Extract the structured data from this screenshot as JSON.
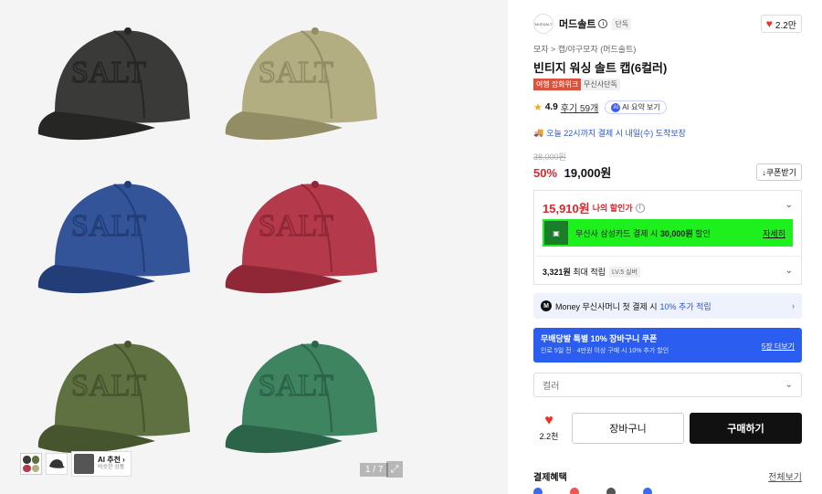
{
  "gallery": {
    "pager": "1 / 7",
    "ai_rec_title": "AI 추천 ›",
    "ai_rec_sub": "비슷한 상품",
    "caps": [
      {
        "color": "#3a3a38",
        "shade": "#262624",
        "text": "SALT"
      },
      {
        "color": "#b3ad82",
        "shade": "#938d65",
        "text": "SALT"
      },
      {
        "color": "#34549a",
        "shade": "#223d78",
        "text": "SALT"
      },
      {
        "color": "#b43a4b",
        "shade": "#8f2736",
        "text": "SALT"
      },
      {
        "color": "#5f7041",
        "shade": "#47552e",
        "text": "SALT"
      },
      {
        "color": "#3e8461",
        "shade": "#2b6449",
        "text": "SALT"
      }
    ]
  },
  "brand": {
    "name": "머드솔트",
    "badge": "단독",
    "likes": "2.2만"
  },
  "breadcrumb": "모자 > 캡/야구모자 (머드솔트)",
  "title": "빈티지 워싱 솔트 캡(6컬러)",
  "tags": {
    "event": "여행 잡화위크",
    "exclusive": "무신사단독"
  },
  "rating": {
    "score": "4.9",
    "reviews": "후기 59개",
    "ai_summary": "AI 요약 보기"
  },
  "delivery": "오늘 22시까지 결제 시 내일(수) 도착보장",
  "price": {
    "original": "38,000원",
    "discount": "50%",
    "sale": "19,000원",
    "coupon_button": "↓쿠폰받기"
  },
  "benefit": {
    "my_price": "15,910원",
    "my_price_label": "나의 할인가",
    "card_text_prefix": "무신사 삼성카드 결제 시 ",
    "card_amount": "30,000원",
    "card_text_suffix": " 할인",
    "card_link": "자세히",
    "points_amount": "3,321원",
    "points_label": " 최대 적립",
    "level": "LV.5 실버"
  },
  "money": {
    "logo": "M",
    "label": "Money 무신사머니 첫 결제 시 ",
    "highlight": "10% 추가 적립"
  },
  "coupon_banner": {
    "title": "무배당발 특별 10% 장바구니 쿠폰",
    "sub": "인로 5일 전 · 4만원 이상 구매 시 10% 추가 할인",
    "link": "5장 더보기"
  },
  "select_placeholder": "컬러",
  "actions": {
    "likes": "2.2천",
    "cart": "장바구니",
    "buy": "구매하기"
  },
  "payment": {
    "title": "결제혜택",
    "more": "전체보기"
  }
}
